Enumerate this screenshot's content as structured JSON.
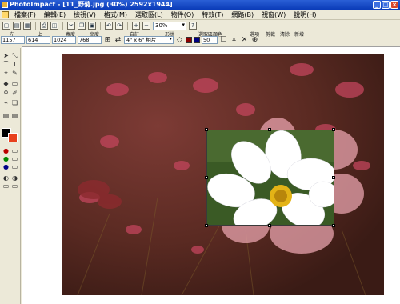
{
  "window": {
    "title": "PhotoImpact - [11_野菊.jpg (30%) 2592x1944]",
    "controls": [
      "_",
      "□",
      "×"
    ]
  },
  "menu": {
    "items": [
      "檔案(F)",
      "編輯(E)",
      "檢視(V)",
      "格式(M)",
      "選取區(L)",
      "物件(O)",
      "特效(T)",
      "網路(B)",
      "視窗(W)",
      "說明(H)"
    ]
  },
  "toolbar": {
    "zoom": "30%",
    "icons": [
      "new-icon",
      "open-icon",
      "save-icon",
      "print-icon",
      "preview-icon",
      "cut-icon",
      "copy-icon",
      "paste-icon",
      "undo-icon",
      "redo-icon",
      "zoom-in-icon",
      "zoom-out-icon",
      "help-icon"
    ]
  },
  "attributes": {
    "labels": {
      "left": "左",
      "top": "上",
      "width": "寬度",
      "height": "高度",
      "custom": "自訂",
      "shape": "形狀",
      "marquee_color": "選取區顏色",
      "options": "選項",
      "crop": "剪裁",
      "clear": "清除",
      "new": "新增"
    },
    "values": {
      "x": "1157",
      "y": "614",
      "w": "1024",
      "h": "768",
      "size_preset": "4\" x 6\" 相片",
      "opacity": "50"
    },
    "colors": {
      "marquee_fg": "#8b0000",
      "marquee_bg": "#000080",
      "fg": "#000000",
      "bg": "#e8411d"
    }
  },
  "lefttools": {
    "icons": [
      "pick-tool-icon",
      "transform-tool-icon",
      "lasso-tool-icon",
      "text-tool-icon",
      "crop-tool-icon",
      "brush-tool-icon",
      "fill-tool-icon",
      "eraser-tool-icon",
      "zoom-tool-icon",
      "eyedropper-tool-icon",
      "path-tool-icon",
      "clone-tool-icon"
    ]
  }
}
